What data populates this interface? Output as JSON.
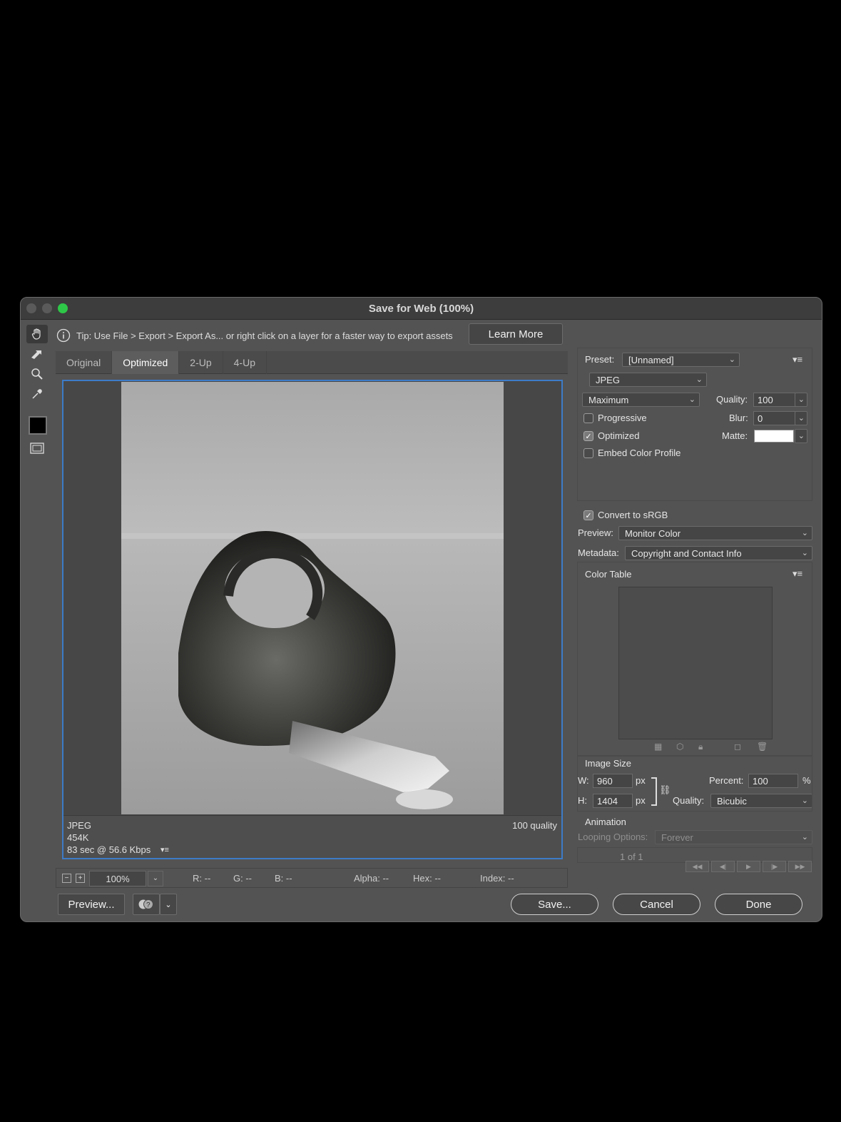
{
  "window": {
    "title": "Save for Web (100%)"
  },
  "tip": {
    "text": "Tip: Use File > Export > Export As...  or right click on a layer for a faster way to export assets",
    "learn_more": "Learn More"
  },
  "tabs": [
    "Original",
    "Optimized",
    "2-Up",
    "4-Up"
  ],
  "pane": {
    "format": "JPEG",
    "size": "454K",
    "time": "83 sec @ 56.6 Kbps",
    "quality": "100 quality"
  },
  "status": {
    "zoom": "100%",
    "r": "R: --",
    "g": "G: --",
    "b": "B: --",
    "alpha": "Alpha: --",
    "hex": "Hex: --",
    "index": "Index: --"
  },
  "buttons": {
    "preview": "Preview...",
    "save": "Save...",
    "cancel": "Cancel",
    "done": "Done"
  },
  "settings": {
    "preset_label": "Preset:",
    "preset_value": "[Unnamed]",
    "format_value": "JPEG",
    "compression_value": "Maximum",
    "quality_label": "Quality:",
    "quality_value": "100",
    "blur_label": "Blur:",
    "blur_value": "0",
    "matte_label": "Matte:",
    "matte_color": "#ffffff",
    "progressive_label": "Progressive",
    "progressive_checked": false,
    "optimized_label": "Optimized",
    "optimized_checked": true,
    "embed_label": "Embed Color Profile",
    "embed_checked": false,
    "convert_label": "Convert to sRGB",
    "convert_checked": true,
    "preview_label": "Preview:",
    "preview_value": "Monitor Color",
    "metadata_label": "Metadata:",
    "metadata_value": "Copyright and Contact Info",
    "color_table_label": "Color Table"
  },
  "image_size": {
    "heading": "Image Size",
    "w_label": "W:",
    "w_value": "960",
    "h_label": "H:",
    "h_value": "1404",
    "px": "px",
    "percent_label": "Percent:",
    "percent_value": "100",
    "percent_unit": "%",
    "quality_label": "Quality:",
    "quality_value": "Bicubic"
  },
  "animation": {
    "heading": "Animation",
    "looping_label": "Looping Options:",
    "looping_value": "Forever",
    "frame_counter": "1 of 1"
  },
  "colors": {
    "accent": "#3d7bc7",
    "dialog_bg": "#535353",
    "maximize": "#2ec748"
  }
}
